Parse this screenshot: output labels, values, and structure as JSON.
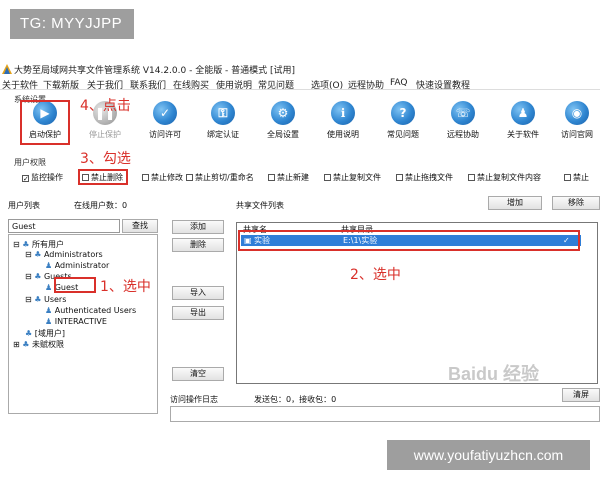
{
  "watermark_top": "TG: MYYJJPP",
  "watermark_bottom": "www.youfatiyuzhcn.com",
  "baidu_mark": "Baidu 经验",
  "window": {
    "title": "大势至局域网共享文件管理系统 V14.2.0.0 - 全能版 - 普通模式 [试用]"
  },
  "menu": [
    "关于软件",
    "下载新版",
    "关于我们",
    "联系我们",
    "在线购买",
    "使用说明",
    "常见问题",
    "选项(O)",
    "远程协助",
    "FAQ",
    "快速设置教程"
  ],
  "system_settings_label": "系统设置",
  "toolbar": [
    {
      "label": "启动保护",
      "icon": "play-icon"
    },
    {
      "label": "停止保护",
      "icon": "pause-icon"
    },
    {
      "label": "访问许可",
      "icon": "access-icon"
    },
    {
      "label": "绑定认证",
      "icon": "bind-icon"
    },
    {
      "label": "全局设置",
      "icon": "settings-icon"
    },
    {
      "label": "使用说明",
      "icon": "manual-icon"
    },
    {
      "label": "常见问题",
      "icon": "help-icon"
    },
    {
      "label": "远程协助",
      "icon": "remote-icon"
    },
    {
      "label": "关于软件",
      "icon": "about-icon"
    },
    {
      "label": "访问官网",
      "icon": "website-icon"
    }
  ],
  "permissions": {
    "label": "用户权限",
    "items": [
      {
        "label": "监控操作",
        "checked": true
      },
      {
        "label": "禁止删除",
        "checked": false
      },
      {
        "label": "禁止修改",
        "checked": false
      },
      {
        "label": "禁止剪切/重命名",
        "checked": false
      },
      {
        "label": "禁止新建",
        "checked": false
      },
      {
        "label": "禁止复制文件",
        "checked": false
      },
      {
        "label": "禁止拖拽文件",
        "checked": false
      },
      {
        "label": "禁止复制文件内容",
        "checked": false
      },
      {
        "label": "禁止",
        "checked": false
      }
    ]
  },
  "user_list": {
    "label": "用户列表",
    "online_label": "在线用户数：",
    "online_count": "0",
    "search_value": "Guest",
    "search_button": "查找",
    "tree": {
      "all_users": "所有用户",
      "administrators": "Administrators",
      "administrator": "Administrator",
      "guests": "Guests",
      "guest": "Guest",
      "users": "Users",
      "authenticated_users": "Authenticated Users",
      "interactive": "INTERACTIVE",
      "domain_users": "[域用户]",
      "unknown_permissions": "未赋权限"
    }
  },
  "buttons": {
    "add": "添加",
    "delete": "删除",
    "import": "导入",
    "export": "导出",
    "clear": "清空",
    "add_share": "增加",
    "remove_share": "移除",
    "clear_log": "清屏"
  },
  "shared_files": {
    "label": "共享文件列表",
    "col_name": "共享名",
    "col_dir": "共享目录",
    "rows": [
      {
        "name": "实验",
        "dir": "E:\\1\\实验",
        "checked": "✓"
      }
    ]
  },
  "log": {
    "label": "访问操作日志",
    "stats": "发送包：0，接收包：0"
  },
  "annotations": {
    "a1": "1、选中",
    "a2": "2、选中",
    "a3": "3、勾选",
    "a4": "4、点击"
  },
  "colors": {
    "annotation_red": "#d9302a",
    "selection_blue": "#2f7ed8",
    "badge_gray": "#9e9e9e"
  }
}
